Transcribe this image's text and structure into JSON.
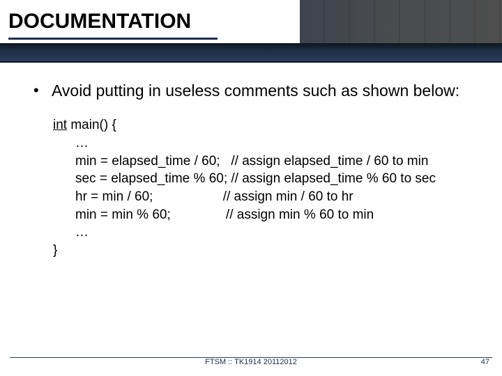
{
  "header": {
    "title": "DOCUMENTATION"
  },
  "bullet": {
    "text": "Avoid putting in useless comments such as shown below:"
  },
  "code": {
    "sig_kw": "int",
    "sig_rest": " main() {",
    "l1": "…",
    "l2": "min = elapsed_time / 60;   // assign elapsed_time / 60 to min",
    "l3": "sec = elapsed_time % 60; // assign elapsed_time % 60 to sec",
    "l4": "hr = min / 60;                   // assign min / 60 to hr",
    "l5": "min = min % 60;               // assign min % 60 to min",
    "l6": "…",
    "close": "}"
  },
  "footer": {
    "center": "FTSM :: TK1914 20112012",
    "page": "47"
  }
}
